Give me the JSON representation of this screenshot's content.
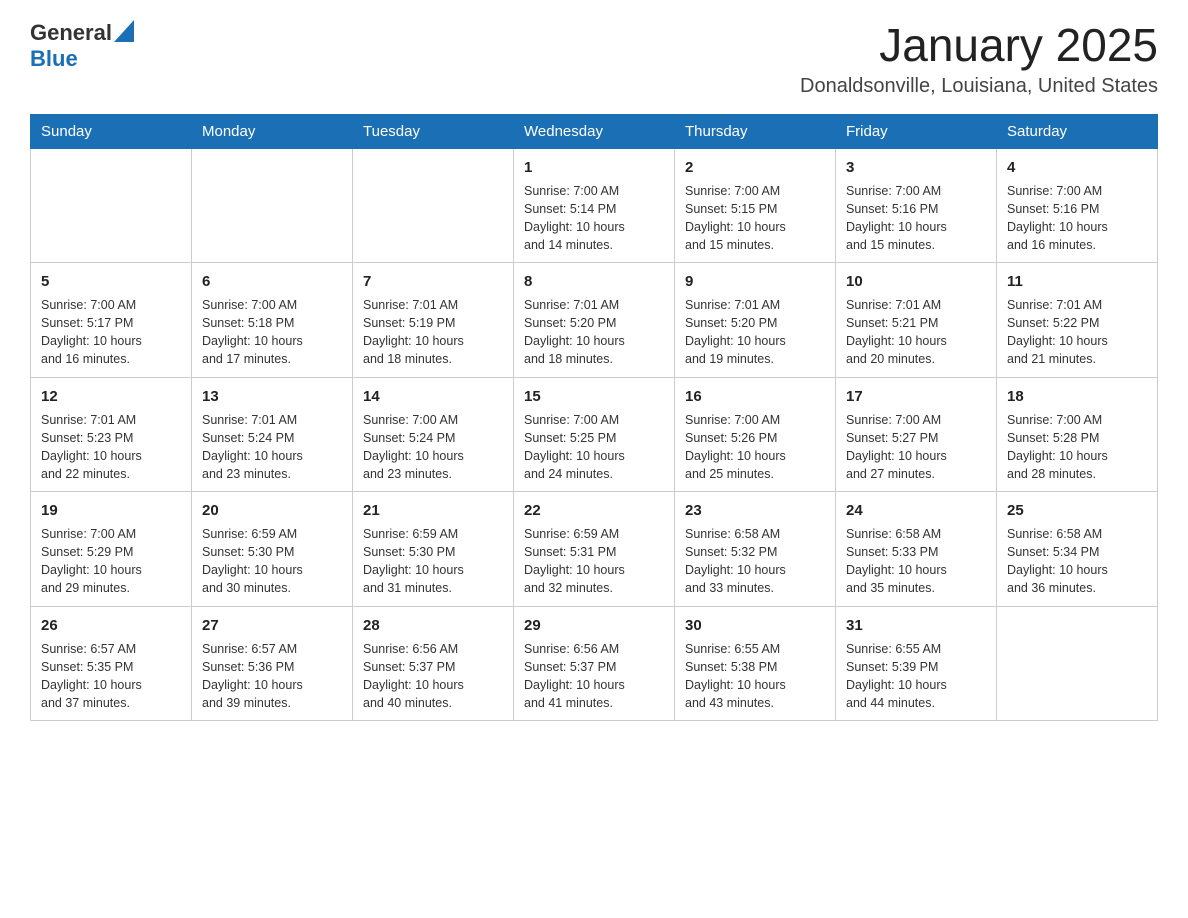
{
  "header": {
    "logo_general": "General",
    "logo_blue": "Blue",
    "title": "January 2025",
    "subtitle": "Donaldsonville, Louisiana, United States"
  },
  "weekdays": [
    "Sunday",
    "Monday",
    "Tuesday",
    "Wednesday",
    "Thursday",
    "Friday",
    "Saturday"
  ],
  "weeks": [
    [
      {
        "day": "",
        "info": ""
      },
      {
        "day": "",
        "info": ""
      },
      {
        "day": "",
        "info": ""
      },
      {
        "day": "1",
        "info": "Sunrise: 7:00 AM\nSunset: 5:14 PM\nDaylight: 10 hours\nand 14 minutes."
      },
      {
        "day": "2",
        "info": "Sunrise: 7:00 AM\nSunset: 5:15 PM\nDaylight: 10 hours\nand 15 minutes."
      },
      {
        "day": "3",
        "info": "Sunrise: 7:00 AM\nSunset: 5:16 PM\nDaylight: 10 hours\nand 15 minutes."
      },
      {
        "day": "4",
        "info": "Sunrise: 7:00 AM\nSunset: 5:16 PM\nDaylight: 10 hours\nand 16 minutes."
      }
    ],
    [
      {
        "day": "5",
        "info": "Sunrise: 7:00 AM\nSunset: 5:17 PM\nDaylight: 10 hours\nand 16 minutes."
      },
      {
        "day": "6",
        "info": "Sunrise: 7:00 AM\nSunset: 5:18 PM\nDaylight: 10 hours\nand 17 minutes."
      },
      {
        "day": "7",
        "info": "Sunrise: 7:01 AM\nSunset: 5:19 PM\nDaylight: 10 hours\nand 18 minutes."
      },
      {
        "day": "8",
        "info": "Sunrise: 7:01 AM\nSunset: 5:20 PM\nDaylight: 10 hours\nand 18 minutes."
      },
      {
        "day": "9",
        "info": "Sunrise: 7:01 AM\nSunset: 5:20 PM\nDaylight: 10 hours\nand 19 minutes."
      },
      {
        "day": "10",
        "info": "Sunrise: 7:01 AM\nSunset: 5:21 PM\nDaylight: 10 hours\nand 20 minutes."
      },
      {
        "day": "11",
        "info": "Sunrise: 7:01 AM\nSunset: 5:22 PM\nDaylight: 10 hours\nand 21 minutes."
      }
    ],
    [
      {
        "day": "12",
        "info": "Sunrise: 7:01 AM\nSunset: 5:23 PM\nDaylight: 10 hours\nand 22 minutes."
      },
      {
        "day": "13",
        "info": "Sunrise: 7:01 AM\nSunset: 5:24 PM\nDaylight: 10 hours\nand 23 minutes."
      },
      {
        "day": "14",
        "info": "Sunrise: 7:00 AM\nSunset: 5:24 PM\nDaylight: 10 hours\nand 23 minutes."
      },
      {
        "day": "15",
        "info": "Sunrise: 7:00 AM\nSunset: 5:25 PM\nDaylight: 10 hours\nand 24 minutes."
      },
      {
        "day": "16",
        "info": "Sunrise: 7:00 AM\nSunset: 5:26 PM\nDaylight: 10 hours\nand 25 minutes."
      },
      {
        "day": "17",
        "info": "Sunrise: 7:00 AM\nSunset: 5:27 PM\nDaylight: 10 hours\nand 27 minutes."
      },
      {
        "day": "18",
        "info": "Sunrise: 7:00 AM\nSunset: 5:28 PM\nDaylight: 10 hours\nand 28 minutes."
      }
    ],
    [
      {
        "day": "19",
        "info": "Sunrise: 7:00 AM\nSunset: 5:29 PM\nDaylight: 10 hours\nand 29 minutes."
      },
      {
        "day": "20",
        "info": "Sunrise: 6:59 AM\nSunset: 5:30 PM\nDaylight: 10 hours\nand 30 minutes."
      },
      {
        "day": "21",
        "info": "Sunrise: 6:59 AM\nSunset: 5:30 PM\nDaylight: 10 hours\nand 31 minutes."
      },
      {
        "day": "22",
        "info": "Sunrise: 6:59 AM\nSunset: 5:31 PM\nDaylight: 10 hours\nand 32 minutes."
      },
      {
        "day": "23",
        "info": "Sunrise: 6:58 AM\nSunset: 5:32 PM\nDaylight: 10 hours\nand 33 minutes."
      },
      {
        "day": "24",
        "info": "Sunrise: 6:58 AM\nSunset: 5:33 PM\nDaylight: 10 hours\nand 35 minutes."
      },
      {
        "day": "25",
        "info": "Sunrise: 6:58 AM\nSunset: 5:34 PM\nDaylight: 10 hours\nand 36 minutes."
      }
    ],
    [
      {
        "day": "26",
        "info": "Sunrise: 6:57 AM\nSunset: 5:35 PM\nDaylight: 10 hours\nand 37 minutes."
      },
      {
        "day": "27",
        "info": "Sunrise: 6:57 AM\nSunset: 5:36 PM\nDaylight: 10 hours\nand 39 minutes."
      },
      {
        "day": "28",
        "info": "Sunrise: 6:56 AM\nSunset: 5:37 PM\nDaylight: 10 hours\nand 40 minutes."
      },
      {
        "day": "29",
        "info": "Sunrise: 6:56 AM\nSunset: 5:37 PM\nDaylight: 10 hours\nand 41 minutes."
      },
      {
        "day": "30",
        "info": "Sunrise: 6:55 AM\nSunset: 5:38 PM\nDaylight: 10 hours\nand 43 minutes."
      },
      {
        "day": "31",
        "info": "Sunrise: 6:55 AM\nSunset: 5:39 PM\nDaylight: 10 hours\nand 44 minutes."
      },
      {
        "day": "",
        "info": ""
      }
    ]
  ]
}
